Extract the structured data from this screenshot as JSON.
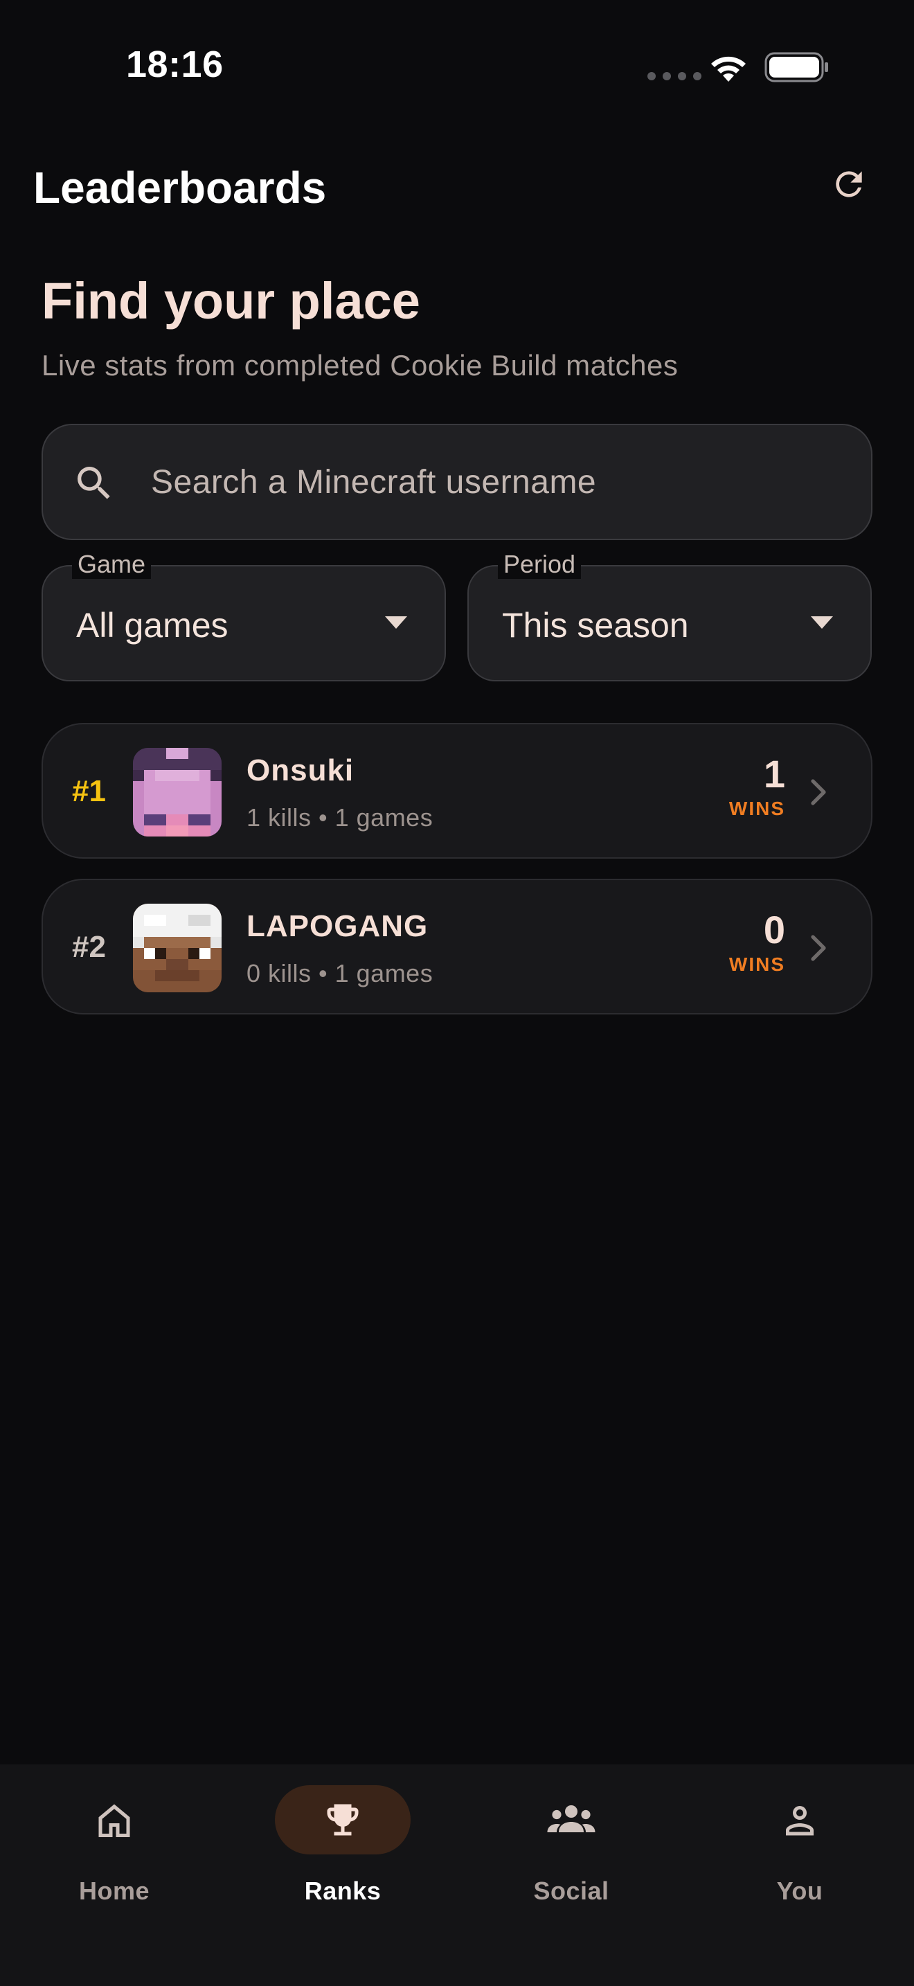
{
  "status_bar": {
    "time": "18:16"
  },
  "header": {
    "title": "Leaderboards",
    "refresh_icon": "refresh-icon"
  },
  "hero": {
    "title": "Find your place",
    "subtitle": "Live stats from completed Cookie Build matches"
  },
  "search": {
    "placeholder": "Search a Minecraft username",
    "value": ""
  },
  "filters": {
    "game": {
      "label": "Game",
      "value": "All games"
    },
    "period": {
      "label": "Period",
      "value": "This season"
    }
  },
  "leaderboard": [
    {
      "rank": "#1",
      "name": "Onsuki",
      "meta": "1 kills • 1 games",
      "wins": "1",
      "wins_label": "WINS",
      "rank_color": "#f5c211"
    },
    {
      "rank": "#2",
      "name": "LAPOGANG",
      "meta": "0 kills • 1 games",
      "wins": "0",
      "wins_label": "WINS",
      "rank_color": "#cfc5c0"
    }
  ],
  "bottom_nav": [
    {
      "label": "Home",
      "icon": "home-icon",
      "active": false
    },
    {
      "label": "Ranks",
      "icon": "trophy-icon",
      "active": true
    },
    {
      "label": "Social",
      "icon": "group-icon",
      "active": false
    },
    {
      "label": "You",
      "icon": "person-icon",
      "active": false
    }
  ],
  "colors": {
    "accent": "#f07d22",
    "gold": "#f5c211",
    "background": "#0b0b0d",
    "active_pill": "#3a2418"
  }
}
